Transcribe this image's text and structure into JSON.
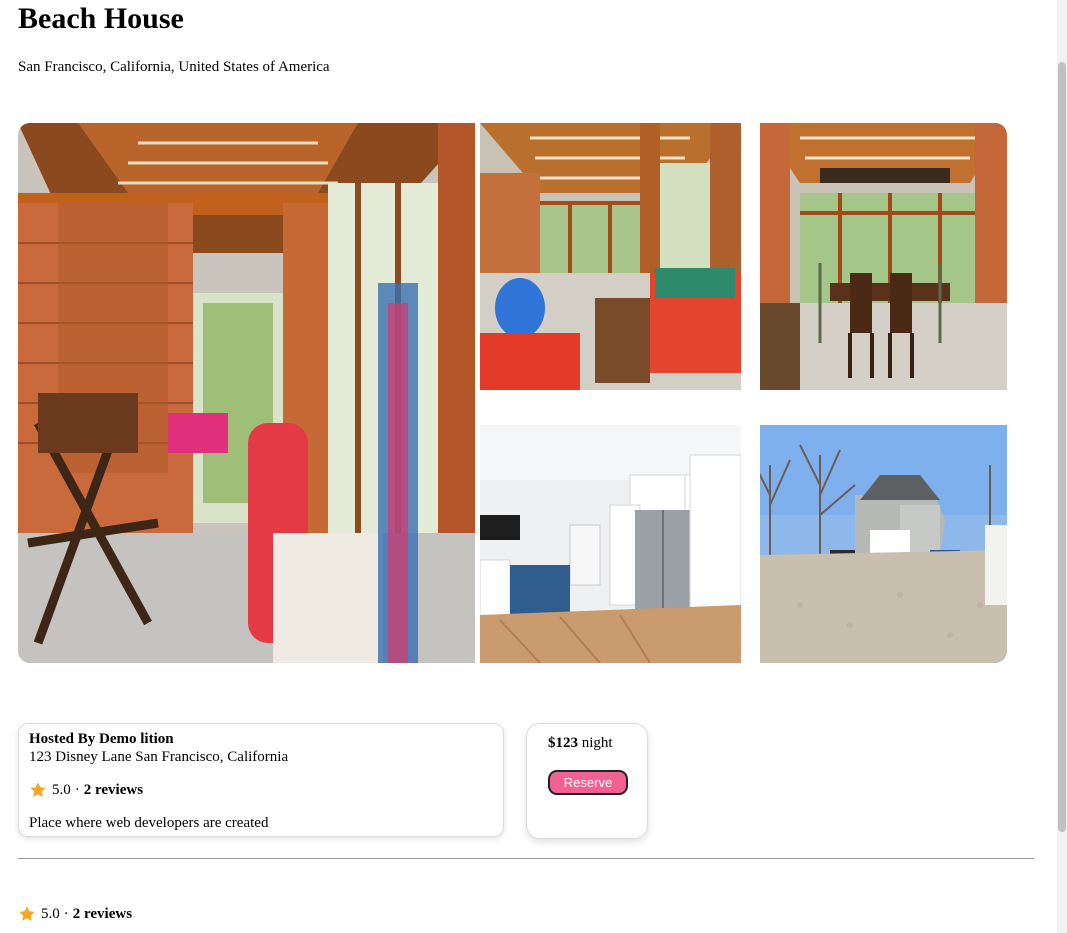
{
  "listing": {
    "title": "Beach House",
    "location": "San Francisco, California, United States of America"
  },
  "gallery": {
    "photos": [
      {
        "name": "veranda-hammock-photo"
      },
      {
        "name": "living-room-photo"
      },
      {
        "name": "dining-room-photo"
      },
      {
        "name": "kitchen-photo"
      },
      {
        "name": "backyard-exterior-photo"
      }
    ]
  },
  "host": {
    "name": "Hosted By Demo lition",
    "address": "123 Disney Lane San Francisco, California",
    "rating": "5.0",
    "separator": "·",
    "reviews": "2 reviews",
    "description": "Place where web developers are created"
  },
  "booking": {
    "price": "$123",
    "unit": "night",
    "reserve_label": "Reserve"
  },
  "reviews_summary": {
    "rating": "5.0",
    "separator": "·",
    "reviews": "2 reviews"
  },
  "colors": {
    "accent": "#f06292",
    "star": "#f5a623"
  },
  "icons": {
    "star": "star-icon"
  }
}
